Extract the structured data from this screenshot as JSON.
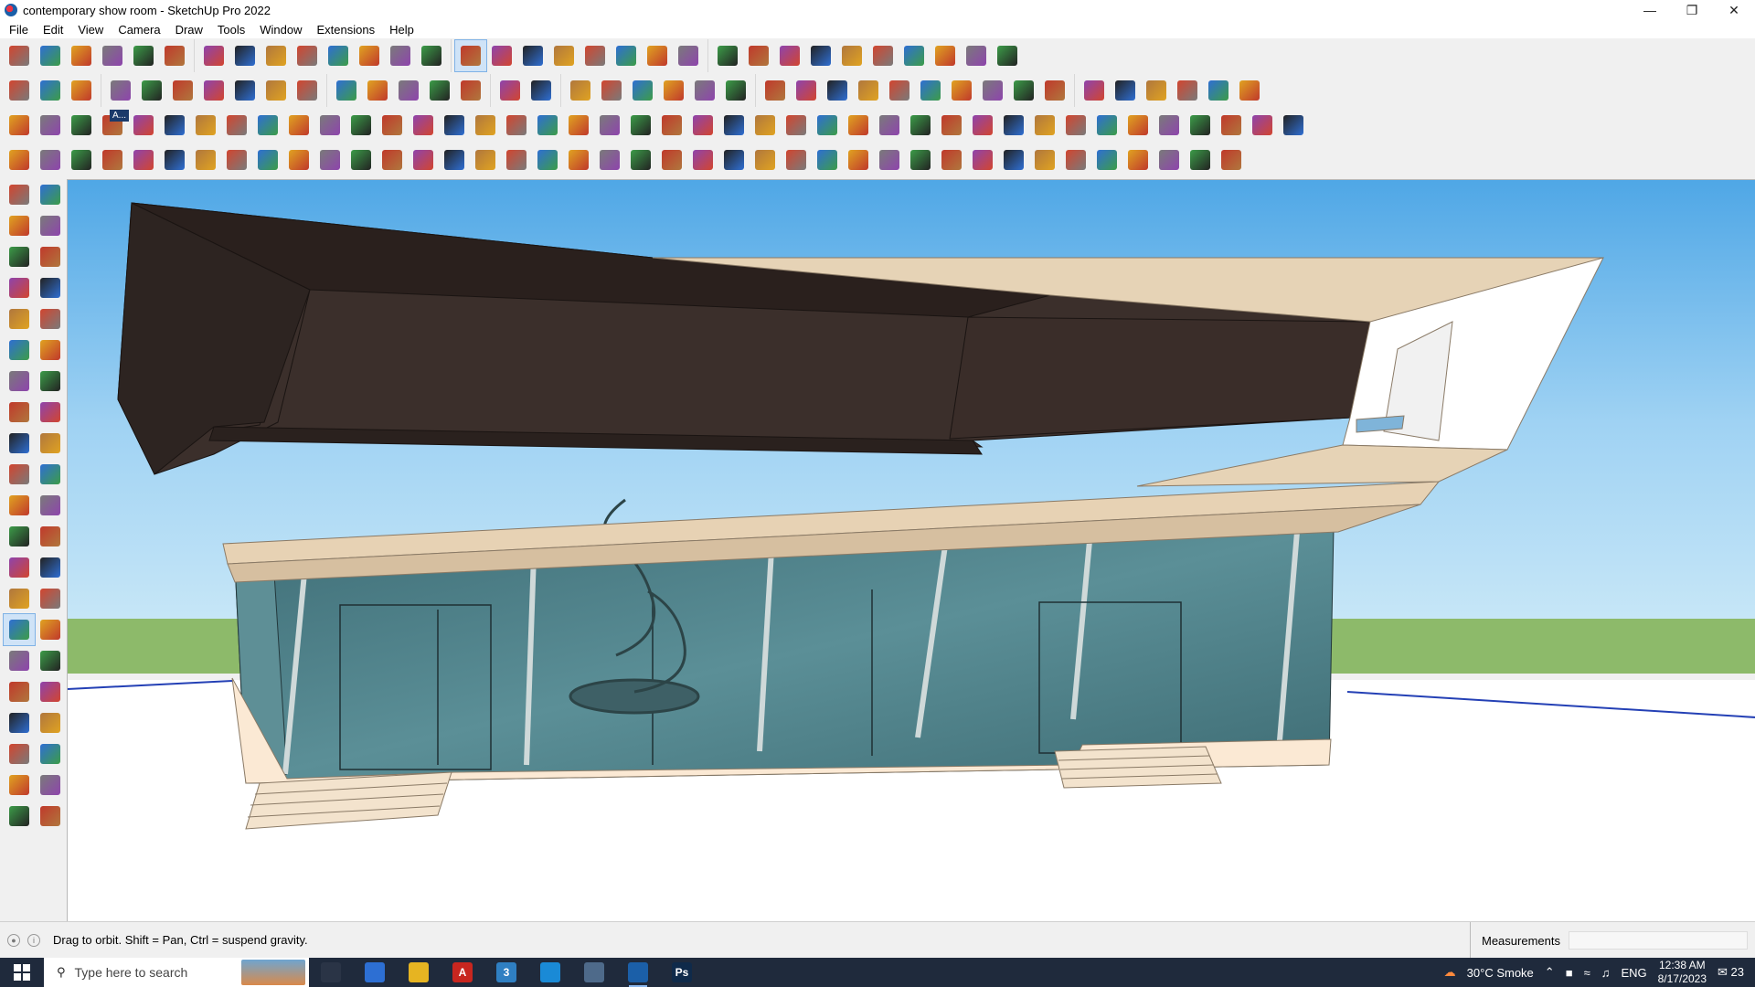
{
  "window": {
    "title": "contemporary show room - SketchUp Pro 2022",
    "controls": [
      "minimize",
      "restore",
      "close"
    ]
  },
  "menu": [
    "File",
    "Edit",
    "View",
    "Camera",
    "Draw",
    "Tools",
    "Window",
    "Extensions",
    "Help"
  ],
  "toolbars": {
    "row1_groups": [
      [
        "zoom-extents",
        "select",
        "eraser",
        "pencil",
        "lasso",
        "paint-bucket"
      ],
      [
        "push-pull",
        "follow-me",
        "move",
        "rotate",
        "scale",
        "tape-measure",
        "text",
        "paint"
      ],
      [
        "orbit",
        "pan",
        "zoom",
        "zoom-window",
        "section",
        "components",
        "layers",
        "materials"
      ],
      [
        "avatar",
        "style",
        "scenes",
        "tags",
        "flip-along",
        "arrange",
        "connect",
        "undo",
        "redo",
        "pin"
      ]
    ],
    "row2_groups": [
      [
        "box",
        "cylinder",
        "sphere"
      ],
      [
        "iso",
        "front",
        "right",
        "back",
        "left",
        "top",
        "bottom"
      ],
      [
        "x-ray",
        "wireframe",
        "hidden-line",
        "shaded",
        "textured"
      ],
      [
        "sandbox-from-contours",
        "sandbox-from-scratch"
      ],
      [
        "warehouse",
        "extension-warehouse",
        "house",
        "shop",
        "house-outline",
        "store"
      ],
      [
        "curve",
        "ruby",
        "shapes-rect",
        "shapes-circle",
        "shapes-polygon",
        "shapes-ellipse",
        "shapes-parallel",
        "shapes-arc",
        "shapes-ring",
        "shapes-spline"
      ],
      [
        "texture-1",
        "texture-2",
        "texture-3",
        "texture-4",
        "texture-5",
        "texture-6"
      ]
    ],
    "row3_label": "A..."
  },
  "status": {
    "hint": "Drag to orbit. Shift = Pan, Ctrl = suspend gravity.",
    "measurements_label": "Measurements"
  },
  "taskbar": {
    "search_placeholder": "Type here to search",
    "apps": [
      {
        "name": "task-view",
        "color": "#2a3446",
        "label": ""
      },
      {
        "name": "calculator",
        "color": "#2d6fd3",
        "label": ""
      },
      {
        "name": "file-explorer",
        "color": "#e6b422",
        "label": ""
      },
      {
        "name": "acrobat",
        "color": "#c8261f",
        "label": "A"
      },
      {
        "name": "app-3",
        "color": "#2f7fc2",
        "label": "3"
      },
      {
        "name": "edge",
        "color": "#1a8ad6",
        "label": ""
      },
      {
        "name": "snipping",
        "color": "#4e6a8a",
        "label": ""
      },
      {
        "name": "sketchup",
        "color": "#1b5fa8",
        "label": ""
      },
      {
        "name": "photoshop",
        "color": "#0f2a4a",
        "label": "Ps"
      }
    ],
    "weather": "30°C  Smoke",
    "language": "ENG",
    "time": "12:38 AM",
    "date": "8/17/2023",
    "notifications": "23"
  },
  "colors": {
    "sky_top": "#5aaee7",
    "sky_bottom": "#b5dcf4",
    "ground": "#ffffff",
    "grass": "#8dba6a",
    "cladding_dark": "#3a2e2a",
    "beige": "#e8d4b8",
    "glass": "#4c7f87",
    "selected_tool": "#cfe3f7"
  }
}
